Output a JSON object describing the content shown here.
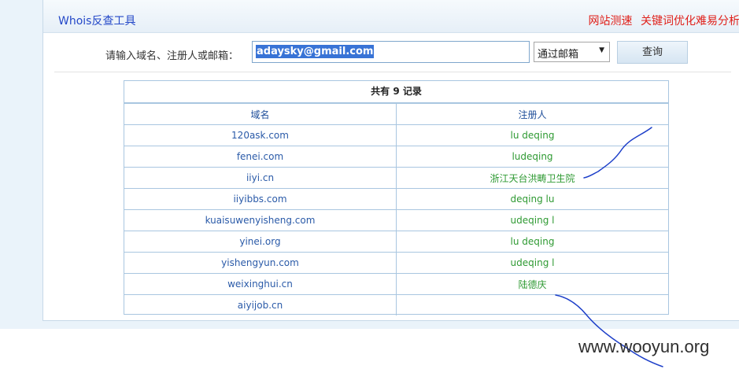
{
  "header": {
    "title": "Whois反查工具",
    "links": [
      "网站测速",
      "关键词优化难易分析"
    ]
  },
  "search": {
    "label": "请输入域名、注册人或邮箱：",
    "value": "adaysky@gmail.com",
    "mode": "通过邮箱",
    "button": "查询"
  },
  "results": {
    "caption": "共有 9 记录",
    "columns": [
      "域名",
      "注册人"
    ],
    "rows": [
      {
        "domain": "120ask.com",
        "registrant": "lu deqing"
      },
      {
        "domain": "fenei.com",
        "registrant": "ludeqing"
      },
      {
        "domain": "iiyi.cn",
        "registrant": "浙江天台洪畴卫生院"
      },
      {
        "domain": "iiyibbs.com",
        "registrant": "deqing lu"
      },
      {
        "domain": "kuaisuwenyisheng.com",
        "registrant": "udeqing l"
      },
      {
        "domain": "yinei.org",
        "registrant": "lu deqing"
      },
      {
        "domain": "yishengyun.com",
        "registrant": "udeqing l"
      },
      {
        "domain": "weixinghui.cn",
        "registrant": "陆德庆"
      },
      {
        "domain": "aiyijob.cn",
        "registrant": ""
      }
    ]
  },
  "watermark": "www.wooyun.org",
  "colors": {
    "title": "#2448c8",
    "links": "#e0201a",
    "domain": "#2a5aa8",
    "registrant": "#2f9a33",
    "annotation": "#1d3fc9"
  }
}
